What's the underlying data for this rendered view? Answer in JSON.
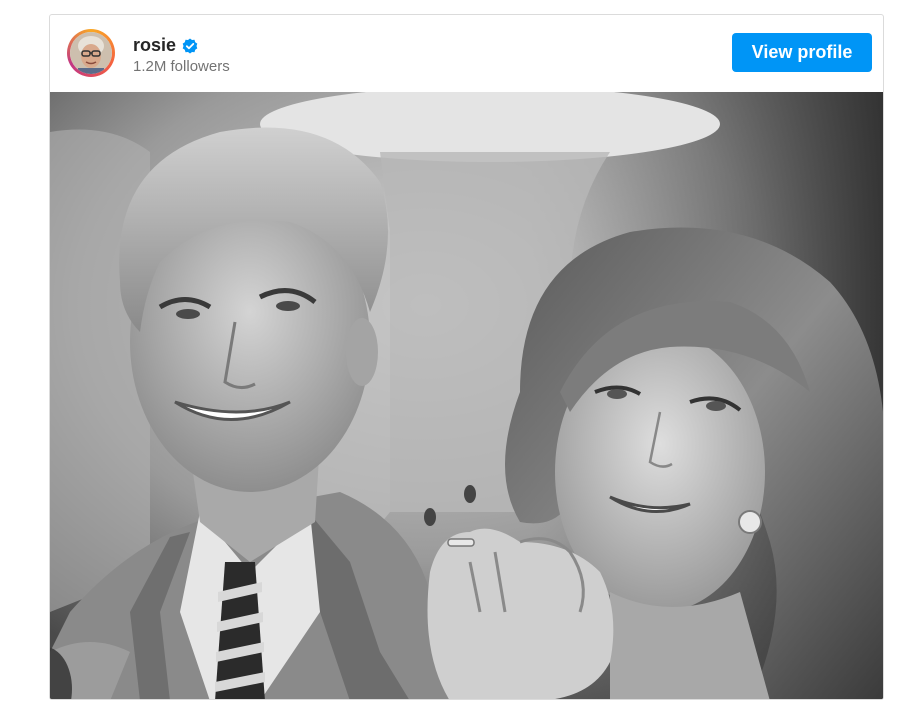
{
  "post": {
    "username": "rosie",
    "verified": true,
    "followers": "1.2M followers",
    "view_profile_label": "View profile",
    "accent_color": "#0095f6"
  },
  "media": {
    "kind": "black-and-white photograph",
    "carousel_prev": "chevron-left-icon"
  }
}
